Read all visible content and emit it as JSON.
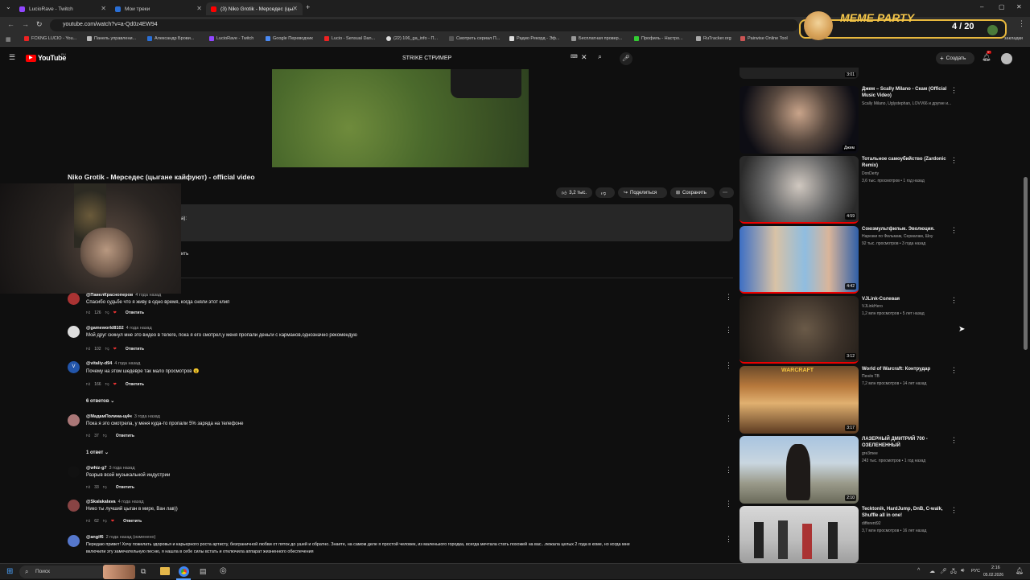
{
  "browser": {
    "tabs": [
      {
        "label": "LucioRave - Twitch",
        "color": "#9146ff"
      },
      {
        "label": "Мои треки",
        "color": "#2a6fd6"
      },
      {
        "label": "(3) Niko Grotik - Мерседес (цы...",
        "color": "#ff0000"
      }
    ],
    "url": "youtube.com/watch?v=a-Qd0z4EW94",
    "bookmarks": [
      "FCKNG LUCIO - You...",
      "Панель управлени...",
      "Александр Брови...",
      "LucioRave - Twitch",
      "Google Переводчик",
      "Lucio - Sensual Dan...",
      "(22) 106_ga_info - П...",
      "Смотреть сериал П...",
      "Радио Рекорд - Эф...",
      "Бесплатная провер...",
      "Профиль - Настро...",
      "RuTracker.org",
      "Pairwise Online Tool"
    ],
    "bm_more": "закладки"
  },
  "yt": {
    "logo": "YouTube",
    "region": "RU",
    "search": "STRIKE СТРИМЕР",
    "create": "Создать",
    "notif": "9+"
  },
  "video": {
    "title": "Niko Grotik - Мерседес (цыгане кайфуют) - official video",
    "likes": "3,2 тыс.",
    "share": "Поделиться",
    "save": "Сохранить",
    "desc_fragment": "а):",
    "desc_fragment2": "ить"
  },
  "comments": [
    {
      "author": "@ПавелКрасноперов",
      "ago": "4 года назад",
      "text": "Спасибо судьбе что  я живу в одно время, когда сняли этот клип",
      "likes": "126",
      "reply": "Ответить",
      "color": "#a33"
    },
    {
      "author": "@gameworld8102",
      "ago": "4 года назад",
      "text": "Мой друг скинул мне это видео в телеге, пока я его смотрел,у меня пропали деньги с карманов,однозначно рекомендую",
      "likes": "102",
      "reply": "Ответить",
      "color": "#ccc"
    },
    {
      "author": "@vitaliy-d94",
      "ago": "4 года назад",
      "text": "Почему на этом шедевре так мало просмотров 😮",
      "likes": "166",
      "reply": "Ответить",
      "color": "#2255aa",
      "expand": "6 ответов"
    },
    {
      "author": "@МадамПолина-щ4ч",
      "ago": "3 года назад",
      "text": "Пока я это смотрела, у меня куда-то пропали 5% заряда на телефоне",
      "likes": "37",
      "reply": "Ответить",
      "color": "#a77",
      "expand": "1 ответ"
    },
    {
      "author": "@whiz-g7",
      "ago": "3 года назад",
      "text": "Разрыв всей музыкальной индустрии",
      "likes": "33",
      "reply": "Ответить",
      "color": "#111"
    },
    {
      "author": "@Skalakalava",
      "ago": "4 года назад",
      "text": "Нико ты лучший цыган в мире, Ван лав))",
      "likes": "62",
      "reply": "Ответить",
      "color": "#844"
    },
    {
      "author": "@angif6",
      "ago": "2 года назад (изменено)",
      "text": "Передаю привет! Хочу пожелать здоровья и карьерного роста артисту, безграничной любви от пяток до ушей и обратно. Знаете, на самом деле я простой человек, из маленького городка, всегда мечтала стать похожей на вас...лежала целых 2 года в коме, но когда мне",
      "text2": "включили эту замечательную песню, я нашла в себе силы встать и отключила аппарат жизненного обеспечения",
      "color": "#5577cc"
    }
  ],
  "related": [
    {
      "title": "Джем – Scally Milano - Скам (Official Music Video)",
      "channel": "Scally Milano, Uglystephan, LOVV66 и другие и...",
      "meta": "",
      "dur": "",
      "badge": "Джем",
      "top_dur": "3:01"
    },
    {
      "title": "Тотальное самоубийство (Zardonic Remix)",
      "channel": "DonDerty",
      "meta": "3,6 тыс. просмотров • 1 год назад",
      "dur": "4:59"
    },
    {
      "title": "Союзмультфильм. Эволюция.",
      "channel": "Нарезки по Фильмам, Сериалам, Шоу",
      "meta": "92 тыс. просмотров • 3 года назад",
      "dur": "4:42"
    },
    {
      "title": "VJLink-Солевая",
      "channel": "VJLinkHero",
      "meta": "1,2 млн просмотров • 5 лет назад",
      "dur": "3:12"
    },
    {
      "title": "World of Warcraft: Контрудар",
      "channel": "Пенёк TB",
      "meta": "7,2 млн просмотров • 14 лет назад",
      "dur": "3:17"
    },
    {
      "title": "ЛАЗЕРНЫЙ ДМИТРИЙ 700 - ОЗЕЛЕНЕННЫЙ",
      "channel": "gre3mee",
      "meta": "243 тыс. просмотров • 1 год назад",
      "dur": "2:10"
    },
    {
      "title": "Tecktonik, HardJump, DnB, C-walk, Shuffle all in one!",
      "channel": "different92",
      "meta": "3,7 млн просмотров • 16 лет назад",
      "dur": ""
    }
  ],
  "overlay": {
    "title": "MEME PARTY",
    "count": "4 / 20"
  },
  "taskbar": {
    "search": "Поиск",
    "lang": "РУС",
    "time": "2:16",
    "date": "05.02.2026"
  }
}
